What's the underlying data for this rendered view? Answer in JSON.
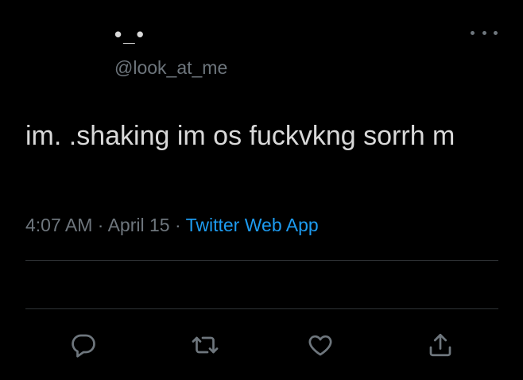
{
  "author": {
    "display_name": "•_•",
    "handle": "@look_at_me"
  },
  "tweet": {
    "text": "im. .shaking im os fuckvkng sorrh m",
    "time": "4:07 AM",
    "separator": "·",
    "date": "April 15",
    "source": "Twitter Web App"
  },
  "actions": [
    {
      "name": "reply",
      "icon": "reply-icon"
    },
    {
      "name": "retweet",
      "icon": "retweet-icon"
    },
    {
      "name": "like",
      "icon": "heart-icon"
    },
    {
      "name": "share",
      "icon": "share-icon"
    }
  ],
  "colors": {
    "background": "#000000",
    "text": "#d9d9d9",
    "secondary": "#6e767d",
    "accent": "#1d9bf0",
    "divider": "#2f3336"
  }
}
